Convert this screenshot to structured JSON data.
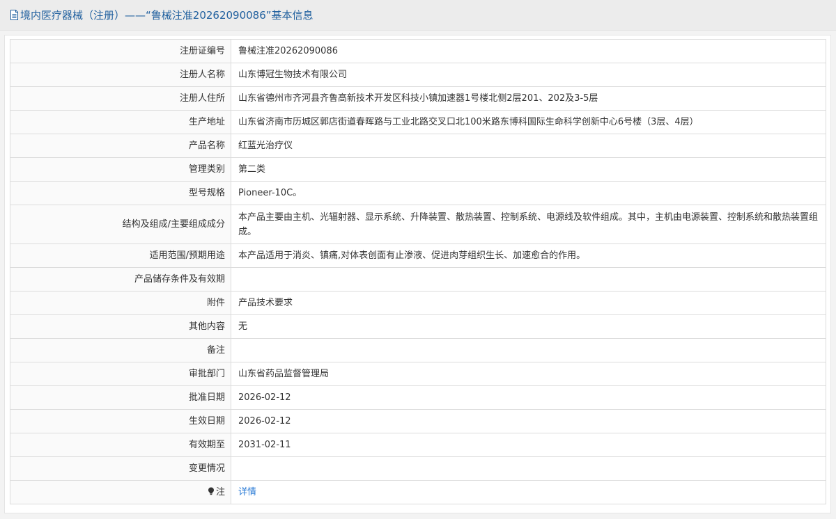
{
  "header": {
    "title": "境内医疗器械（注册）——“鲁械注准20262090086”基本信息",
    "icon": "document-icon"
  },
  "rows": [
    {
      "label": "注册证编号",
      "value": "鲁械注准20262090086"
    },
    {
      "label": "注册人名称",
      "value": "山东博冠生物技术有限公司"
    },
    {
      "label": "注册人住所",
      "value": "山东省德州市齐河县齐鲁高新技术开发区科技小镇加速器1号楼北侧2层201、202及3-5层"
    },
    {
      "label": "生产地址",
      "value": "山东省济南市历城区郭店街道春晖路与工业北路交叉口北100米路东博科国际生命科学创新中心6号楼（3层、4层）"
    },
    {
      "label": "产品名称",
      "value": "红蓝光治疗仪"
    },
    {
      "label": "管理类别",
      "value": "第二类"
    },
    {
      "label": "型号规格",
      "value": "Pioneer-10C。"
    },
    {
      "label": "结构及组成/主要组成成分",
      "value": "本产品主要由主机、光辐射器、显示系统、升降装置、散热装置、控制系统、电源线及软件组成。其中，主机由电源装置、控制系统和散热装置组成。"
    },
    {
      "label": "适用范围/预期用途",
      "value": "本产品适用于消炎、镇痛,对体表创面有止渗液、促进肉芽组织生长、加速愈合的作用。"
    },
    {
      "label": "产品储存条件及有效期",
      "value": ""
    },
    {
      "label": "附件",
      "value": "产品技术要求"
    },
    {
      "label": "其他内容",
      "value": "无"
    },
    {
      "label": "备注",
      "value": ""
    },
    {
      "label": "审批部门",
      "value": "山东省药品监督管理局"
    },
    {
      "label": "批准日期",
      "value": "2026-02-12"
    },
    {
      "label": "生效日期",
      "value": "2026-02-12"
    },
    {
      "label": "有效期至",
      "value": "2031-02-11"
    },
    {
      "label": "变更情况",
      "value": ""
    }
  ],
  "note": {
    "label": "注",
    "icon": "lightbulb-icon",
    "link_text": "详情"
  },
  "colors": {
    "title": "#1f5f9e",
    "link": "#2a7bd6",
    "border": "#dcdcdc"
  }
}
